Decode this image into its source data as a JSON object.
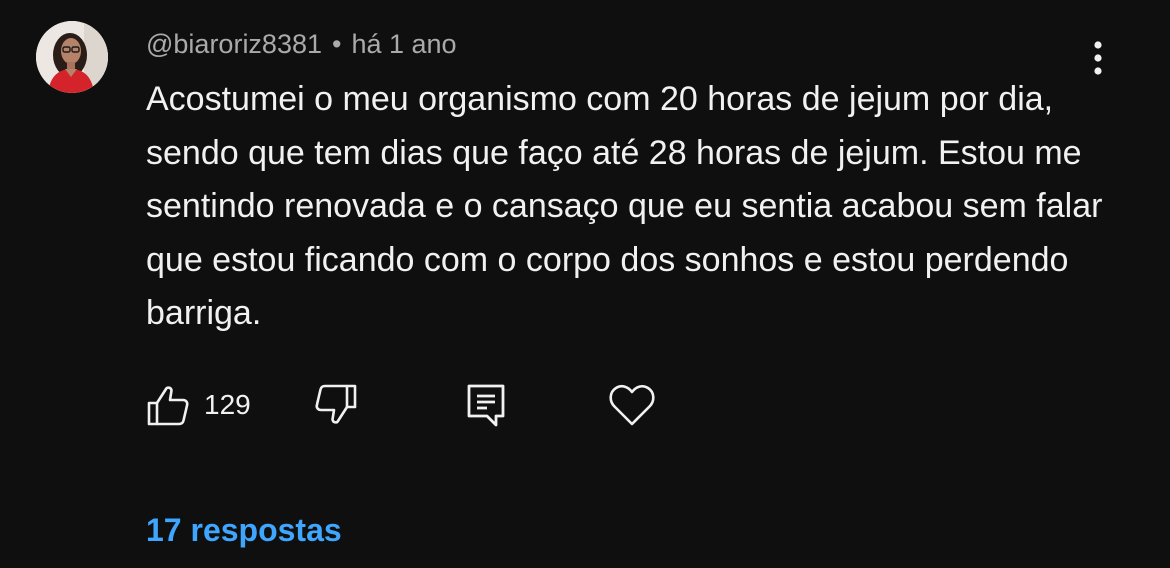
{
  "comment": {
    "author": "@biaroriz8381",
    "separator": "•",
    "timestamp": "há 1 ano",
    "text": "Acostumei o meu organismo com 20 horas de jejum por dia, sendo que tem dias que faço até 28 horas de jejum. Estou me sentindo renovada e o cansaço que eu sentia acabou sem falar que estou ficando com o corpo dos sonhos e estou perdendo barriga."
  },
  "actions": {
    "like_count": "129",
    "like_icon": "thumbs-up-icon",
    "dislike_icon": "thumbs-down-icon",
    "reply_icon": "comment-reply-icon",
    "heart_icon": "heart-icon",
    "menu_icon": "more-vertical-icon"
  },
  "replies": {
    "label": "17 respostas"
  },
  "colors": {
    "background": "#0f0f0f",
    "text": "#f1f1f1",
    "secondary_text": "#aaaaaa",
    "link": "#3ea6ff"
  }
}
